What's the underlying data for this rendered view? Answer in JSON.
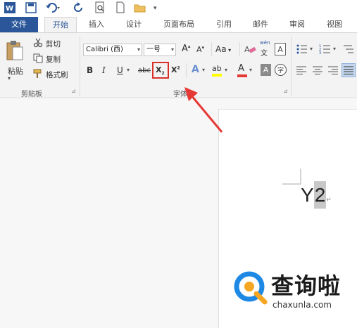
{
  "qat": {
    "app_icon": "word-icon",
    "items": [
      "save-icon",
      "undo-icon",
      "redo-icon",
      "print-preview-icon",
      "new-document-icon",
      "open-folder-icon",
      "customize-icon"
    ]
  },
  "tabs": [
    {
      "label": "文件"
    },
    {
      "label": "开始"
    },
    {
      "label": "插入"
    },
    {
      "label": "设计"
    },
    {
      "label": "页面布局"
    },
    {
      "label": "引用"
    },
    {
      "label": "邮件"
    },
    {
      "label": "审阅"
    },
    {
      "label": "视图"
    }
  ],
  "clipboard": {
    "paste_label": "粘贴",
    "cut_label": "剪切",
    "copy_label": "复制",
    "format_painter_label": "格式刷",
    "group_label": "剪贴板"
  },
  "font": {
    "font_name": "Calibri (西)",
    "font_size": "一号",
    "grow_label": "A",
    "shrink_label": "A",
    "case_label": "Aa",
    "phonetic_top": "wén",
    "phonetic_bottom": "文",
    "border_label": "A",
    "bold_label": "B",
    "italic_label": "I",
    "underline_label": "U",
    "strike_label": "abc",
    "subscript_label": "X",
    "subscript_small": "2",
    "superscript_label": "X",
    "superscript_small": "2",
    "effects_label": "A",
    "highlight_label": "ab",
    "color_label": "A",
    "shading_label": "A",
    "enclose_label": "字",
    "group_label": "字体"
  },
  "document": {
    "text_main": "Y",
    "text_selected": "2",
    "para_mark": "↵"
  },
  "watermark": {
    "logo_char": "Q",
    "title": "查询啦",
    "url": "chaxunla.com"
  },
  "colors": {
    "file_tab": "#2b579a",
    "highlight_box": "#d9302a",
    "arrow": "#e53935",
    "selection": "#c8c8c8",
    "watermark_blue": "#1e88e5",
    "watermark_orange": "#f5a623"
  }
}
